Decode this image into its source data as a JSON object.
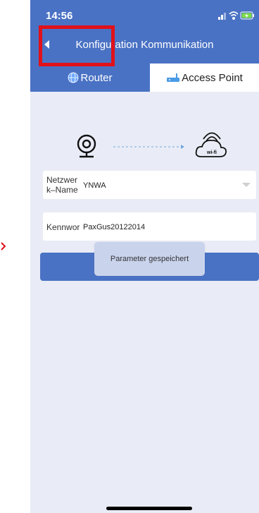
{
  "status_bar": {
    "time": "14:56"
  },
  "nav": {
    "title": "Konfiguration Kommunikation"
  },
  "tabs": {
    "router": "Router",
    "access_point": "Access Point"
  },
  "diagram": {
    "wifi_label": "wi-fi"
  },
  "form": {
    "network_label": "Netzwerk-Name",
    "network_label_line1": "Netzwer",
    "network_label_line2": "k–Name",
    "network_value": "YNWA",
    "password_label": "Kennwort",
    "password_label_visible": "Kennwor",
    "password_value": "PaxGus20122014"
  },
  "toast": {
    "message": "Parameter gespeichert"
  },
  "colors": {
    "primary": "#4a72c4",
    "background": "#e9ecf6",
    "highlight": "#e0111a"
  }
}
